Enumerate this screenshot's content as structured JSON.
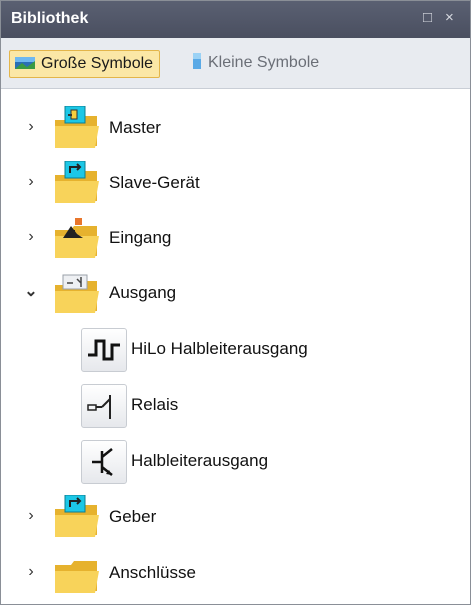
{
  "panel": {
    "title": "Bibliothek",
    "controls": {
      "restore": "□",
      "close": "×"
    }
  },
  "toolbar": {
    "large_icons_label": "Große Symbole",
    "small_icons_label": "Kleine Symbole"
  },
  "tree": {
    "master": {
      "label": "Master",
      "chevron": "›"
    },
    "slave": {
      "label": "Slave-Gerät",
      "chevron": "›"
    },
    "eingang": {
      "label": "Eingang",
      "chevron": "›"
    },
    "ausgang": {
      "label": "Ausgang",
      "chevron": "⌄",
      "children": {
        "hilo": {
          "label": "HiLo Halbleiterausgang"
        },
        "relais": {
          "label": "Relais"
        },
        "halbleiter": {
          "label": "Halbleiterausgang"
        }
      }
    },
    "geber": {
      "label": "Geber",
      "chevron": "›"
    },
    "anschluesse": {
      "label": "Anschlüsse",
      "chevron": "›"
    }
  },
  "colors": {
    "accent_yellow": "#fbe7a6",
    "folder_yellow": "#f6cf3f",
    "cyan_badge": "#1cc7e6"
  }
}
